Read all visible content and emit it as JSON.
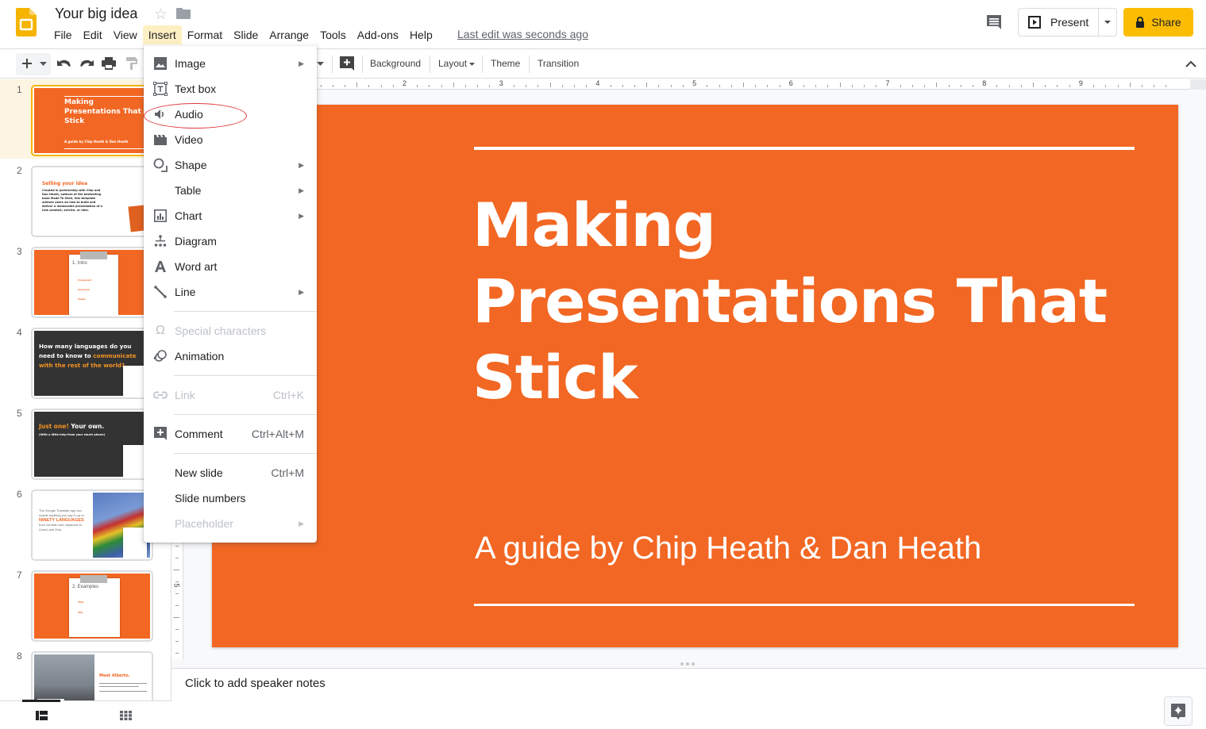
{
  "app": {
    "document_title": "Your big idea",
    "last_edit": "Last edit was seconds ago",
    "brand_color": "#fbbc04",
    "slide_color": "#f26723"
  },
  "menubar": {
    "items": [
      "File",
      "Edit",
      "View",
      "Insert",
      "Format",
      "Slide",
      "Arrange",
      "Tools",
      "Add-ons",
      "Help"
    ],
    "active": "Insert"
  },
  "header_buttons": {
    "present": "Present",
    "share": "Share"
  },
  "toolbar": {
    "background": "Background",
    "layout": "Layout",
    "theme": "Theme",
    "transition": "Transition"
  },
  "insert_menu": {
    "items": [
      {
        "label": "Image",
        "icon": "image-icon",
        "submenu": true,
        "disabled": false
      },
      {
        "label": "Text box",
        "icon": "text-box-icon",
        "submenu": false,
        "disabled": false
      },
      {
        "label": "Audio",
        "icon": "audio-icon",
        "submenu": false,
        "disabled": false,
        "highlighted": true
      },
      {
        "label": "Video",
        "icon": "video-icon",
        "submenu": false,
        "disabled": false
      },
      {
        "label": "Shape",
        "icon": "shape-icon",
        "submenu": true,
        "disabled": false
      },
      {
        "label": "Table",
        "icon": "",
        "submenu": true,
        "disabled": false
      },
      {
        "label": "Chart",
        "icon": "chart-icon",
        "submenu": true,
        "disabled": false
      },
      {
        "label": "Diagram",
        "icon": "diagram-icon",
        "submenu": false,
        "disabled": false
      },
      {
        "label": "Word art",
        "icon": "word-art-icon",
        "submenu": false,
        "disabled": false
      },
      {
        "label": "Line",
        "icon": "line-icon",
        "submenu": true,
        "disabled": false
      },
      {
        "label": "Special characters",
        "icon": "omega-icon",
        "submenu": false,
        "disabled": true
      },
      {
        "label": "Animation",
        "icon": "animation-icon",
        "submenu": false,
        "disabled": false
      },
      {
        "label": "Link",
        "icon": "link-icon",
        "shortcut": "Ctrl+K",
        "disabled": true
      },
      {
        "label": "Comment",
        "icon": "add-comment-icon",
        "shortcut": "Ctrl+Alt+M",
        "disabled": false
      },
      {
        "label": "New slide",
        "icon": "",
        "shortcut": "Ctrl+M",
        "disabled": false
      },
      {
        "label": "Slide numbers",
        "icon": "",
        "disabled": false
      },
      {
        "label": "Placeholder",
        "icon": "",
        "submenu": true,
        "disabled": true
      }
    ]
  },
  "ruler": {
    "horizontal_labels": [
      "2",
      "3",
      "4",
      "5",
      "6",
      "7",
      "8",
      "9"
    ],
    "vertical_labels": [
      "5"
    ]
  },
  "slide": {
    "title": "Making Presentations That Stick",
    "title_lines": [
      "Making",
      "Presentations That",
      "Stick"
    ],
    "subtitle": "A guide by Chip Heath & Dan Heath"
  },
  "filmstrip": {
    "slides": [
      {
        "number": "1",
        "title_lines": [
          "Making",
          "Presentations That",
          "Stick"
        ],
        "subtitle": "A guide by Chip Heath & Dan Heath",
        "selected": true
      },
      {
        "number": "2",
        "title": "Selling your idea",
        "body": "Created in partnership with Chip and Dan Heath, authors of the bestselling book Made To Stick, this template advises users on how to build and deliver a memorable presentation of a new product, service, or idea."
      },
      {
        "number": "3",
        "title": "1. Intro",
        "bullets": [
          "Unexpected",
          "Emotional",
          "Simple"
        ]
      },
      {
        "number": "4",
        "title_white": "How many languages do you need to know to",
        "title_orange": "communicate with the rest of the world?"
      },
      {
        "number": "5",
        "title_orange": "Just one!",
        "title_white": "Your own.",
        "subtitle": "(With a little help from your smart phone)"
      },
      {
        "number": "6",
        "text_pre": "The Google Translate app can repeat anything you say in up to",
        "text_highlight": "NINETY LANGUAGES",
        "text_post": "from German and Japanese to Czech and Zulu."
      },
      {
        "number": "7",
        "title": "2. Examples",
        "bullets": [
          "What",
          "Why"
        ]
      },
      {
        "number": "8",
        "title": "Meet Alberto."
      }
    ]
  },
  "notes": {
    "placeholder": "Click to add speaker notes"
  }
}
